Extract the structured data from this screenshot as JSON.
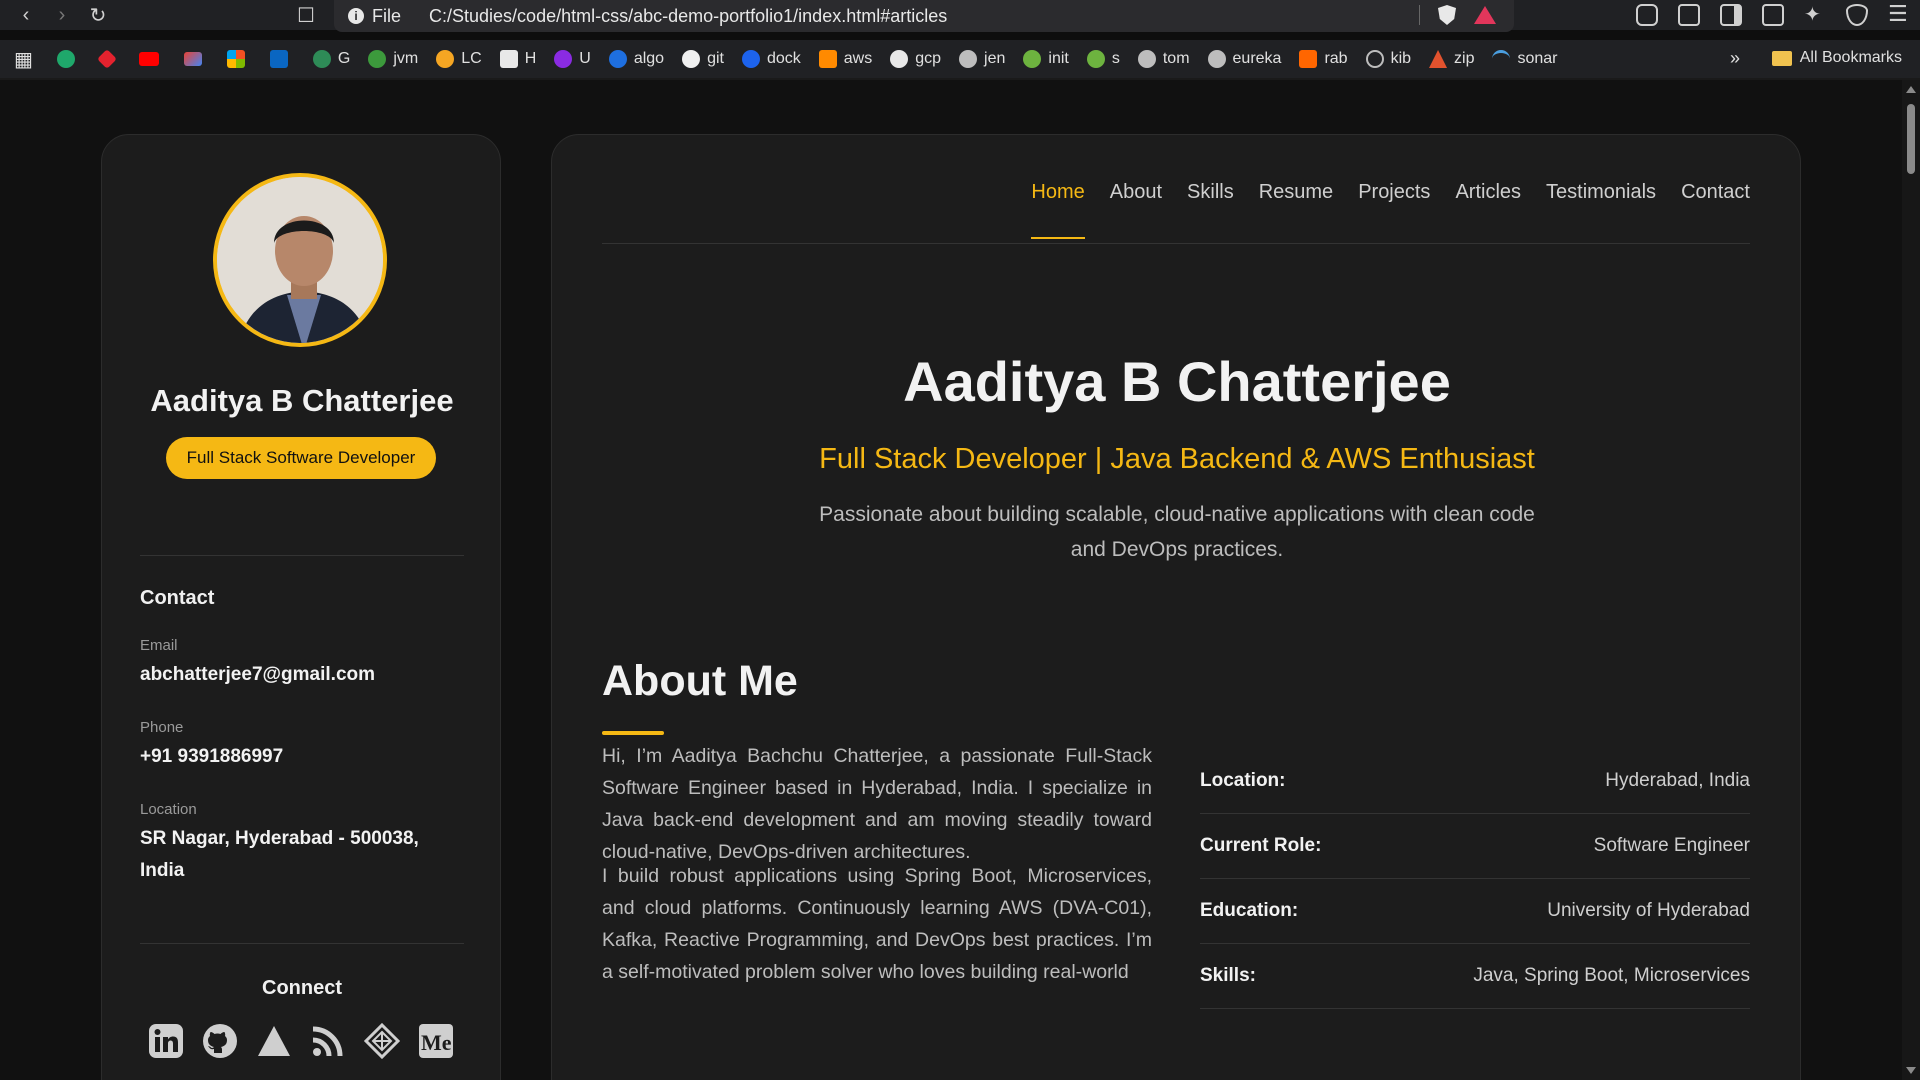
{
  "browser": {
    "url_scheme_label": "File",
    "url": "C:/Studies/code/html-css/abc-demo-portfolio1/index.html#articles",
    "bookmarks": [
      "G",
      "jvm",
      "LC",
      "H",
      "U",
      "algo",
      "git",
      "dock",
      "aws",
      "gcp",
      "jen",
      "init",
      "s",
      "tom",
      "eureka",
      "rab",
      "kib",
      "zip",
      "sonar"
    ],
    "bookmarks_more": "»",
    "all_bookmarks": "All Bookmarks"
  },
  "sidebar": {
    "name": "Aaditya B Chatterjee",
    "role": "Full Stack Software Developer",
    "contact_title": "Contact",
    "email_label": "Email",
    "email": "abchatterjee7@gmail.com",
    "phone_label": "Phone",
    "phone": "+91 9391886997",
    "location_label": "Location",
    "location": "SR Nagar, Hyderabad - 500038, India",
    "connect_title": "Connect",
    "socials": [
      "linkedin-icon",
      "github-icon",
      "triangle-icon",
      "rss-icon",
      "diamond-icon",
      "medium-icon"
    ]
  },
  "nav": {
    "items": [
      "Home",
      "About",
      "Skills",
      "Resume",
      "Projects",
      "Articles",
      "Testimonials",
      "Contact"
    ],
    "active": "Home"
  },
  "hero": {
    "title": "Aaditya B Chatterjee",
    "subtitle": "Full Stack Developer | Java Backend & AWS Enthusiast",
    "description": "Passionate about building scalable, cloud-native applications with clean code and DevOps practices."
  },
  "about": {
    "title": "About Me",
    "paragraphs": [
      "Hi, I’m Aaditya Bachchu Chatterjee, a passionate Full-Stack Software Engineer based in Hyderabad, India. I specialize in Java back-end development and am moving steadily toward cloud-native, DevOps-driven architectures.",
      "I build robust applications using Spring Boot, Microservices, and cloud platforms. Continuously learning AWS (DVA-C01), Kafka, Reactive Programming, and DevOps best practices. I’m a self-motivated problem solver who loves building real-world"
    ],
    "info": [
      {
        "key": "Location:",
        "value": "Hyderabad, India"
      },
      {
        "key": "Current Role:",
        "value": "Software Engineer"
      },
      {
        "key": "Education:",
        "value": "University of Hyderabad"
      },
      {
        "key": "Skills:",
        "value": "Java, Spring Boot, Microservices"
      }
    ]
  },
  "colors": {
    "accent": "#f5b814",
    "background": "#111111",
    "card": "#1c1c1c"
  }
}
